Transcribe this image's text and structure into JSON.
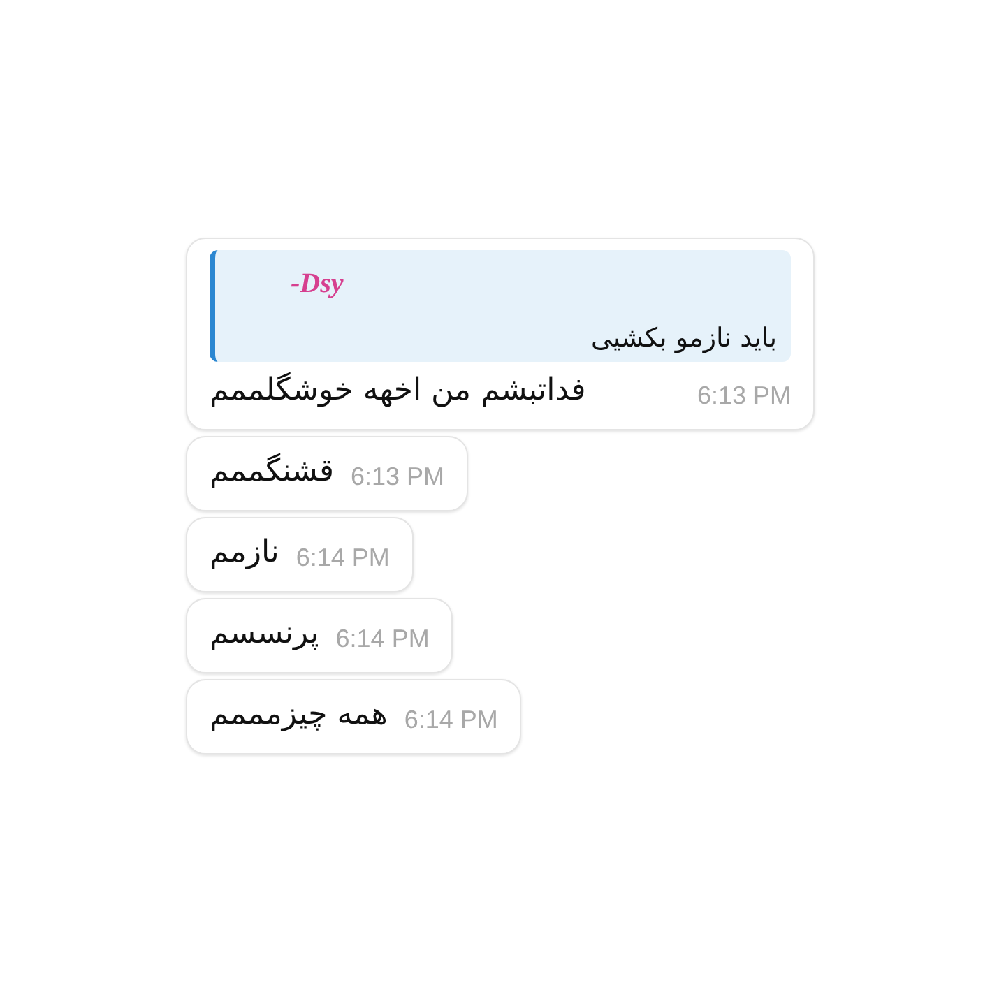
{
  "messages": [
    {
      "reply": {
        "sender": "-Dsy",
        "text": "باید نازمو بکشیی"
      },
      "text": "فداتبشم من اخهه خوشگلممم",
      "time": "6:13 PM"
    },
    {
      "text": "قشنگممم",
      "time": "6:13 PM"
    },
    {
      "text": "نازمم",
      "time": "6:14 PM"
    },
    {
      "text": "پرنسسم",
      "time": "6:14 PM"
    },
    {
      "text": "همه چیزمممم",
      "time": "6:14 PM"
    }
  ]
}
